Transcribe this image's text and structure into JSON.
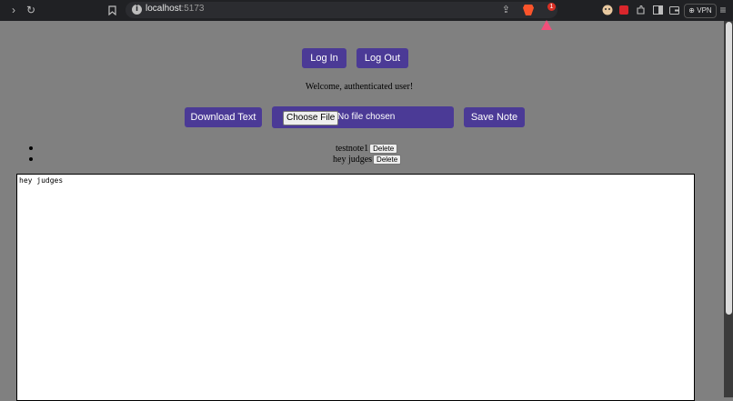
{
  "browser": {
    "url_host": "localhost",
    "url_port": ":5173",
    "vpn_label": "VPN",
    "bat_badge": "1",
    "icons": [
      "forward-icon",
      "reload-icon",
      "bookmark-icon",
      "site-info-icon",
      "share-icon",
      "brave-shields-icon",
      "brave-rewards-icon",
      "profile-icon",
      "extension-red-icon",
      "extensions-icon",
      "sidebar-icon",
      "wallet-icon",
      "menu-icon"
    ]
  },
  "auth": {
    "login_label": "Log In",
    "logout_label": "Log Out",
    "welcome_text": "Welcome, authenticated user!"
  },
  "toolbar": {
    "download_label": "Download Text",
    "choose_file_label": "Choose File",
    "no_file_text": "No file chosen",
    "save_label": "Save Note"
  },
  "notes": [
    {
      "title": "testnote1",
      "delete_label": "Delete"
    },
    {
      "title": "hey judges",
      "delete_label": "Delete"
    }
  ],
  "editor": {
    "content": "hey judges"
  },
  "colors": {
    "page_bg": "#808080",
    "button_bg": "#4b3a96",
    "chrome_bg": "#202124"
  }
}
